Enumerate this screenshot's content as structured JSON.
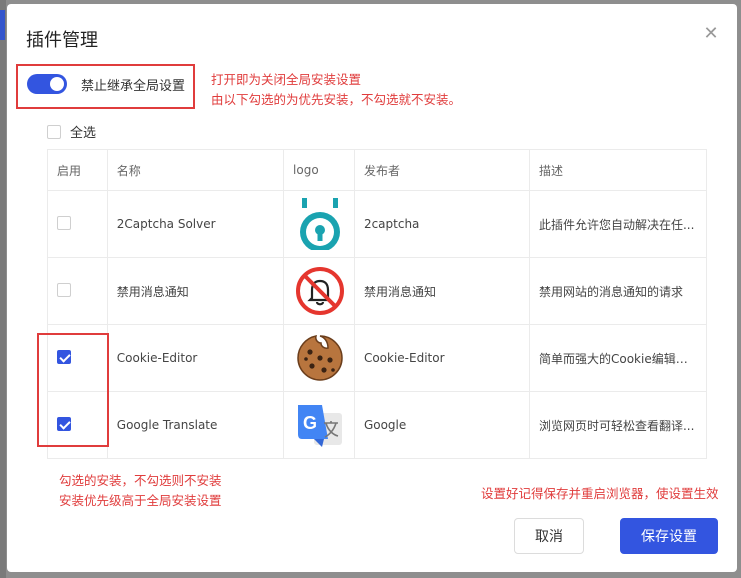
{
  "dialog": {
    "title": "插件管理",
    "close_icon": "close-icon"
  },
  "toggle": {
    "label": "禁止继承全局设置",
    "on": true
  },
  "notes": {
    "toggle_line1": "打开即为关闭全局安装设置",
    "toggle_line2": "由以下勾选的为优先安装，不勾选就不安装。",
    "checkbox_line1": "勾选的安装，不勾选则不安装",
    "checkbox_line2": "安装优先级高于全局安装设置",
    "save_hint": "设置好记得保存并重启浏览器，使设置生效"
  },
  "select_all": {
    "label": "全选",
    "checked": false
  },
  "table": {
    "headers": [
      "启用",
      "名称",
      "logo",
      "发布者",
      "描述"
    ],
    "rows": [
      {
        "checked": false,
        "name": "2Captcha Solver",
        "logo": "2captcha-logo",
        "publisher": "2captcha",
        "description": "此插件允许您自动解决在任..."
      },
      {
        "checked": false,
        "name": "禁用消息通知",
        "logo": "no-notification-logo",
        "publisher": "禁用消息通知",
        "description": "禁用网站的消息通知的请求"
      },
      {
        "checked": true,
        "name": "Cookie-Editor",
        "logo": "cookie-logo",
        "publisher": "Cookie-Editor",
        "description": "简单而强大的Cookie编辑器..."
      },
      {
        "checked": true,
        "name": "Google Translate",
        "logo": "google-translate-logo",
        "publisher": "Google",
        "description": "浏览网页时可轻松查看翻译..."
      }
    ]
  },
  "buttons": {
    "cancel": "取消",
    "save": "保存设置"
  },
  "colors": {
    "accent": "#3355e0",
    "annotation_red": "#e03c3c"
  }
}
